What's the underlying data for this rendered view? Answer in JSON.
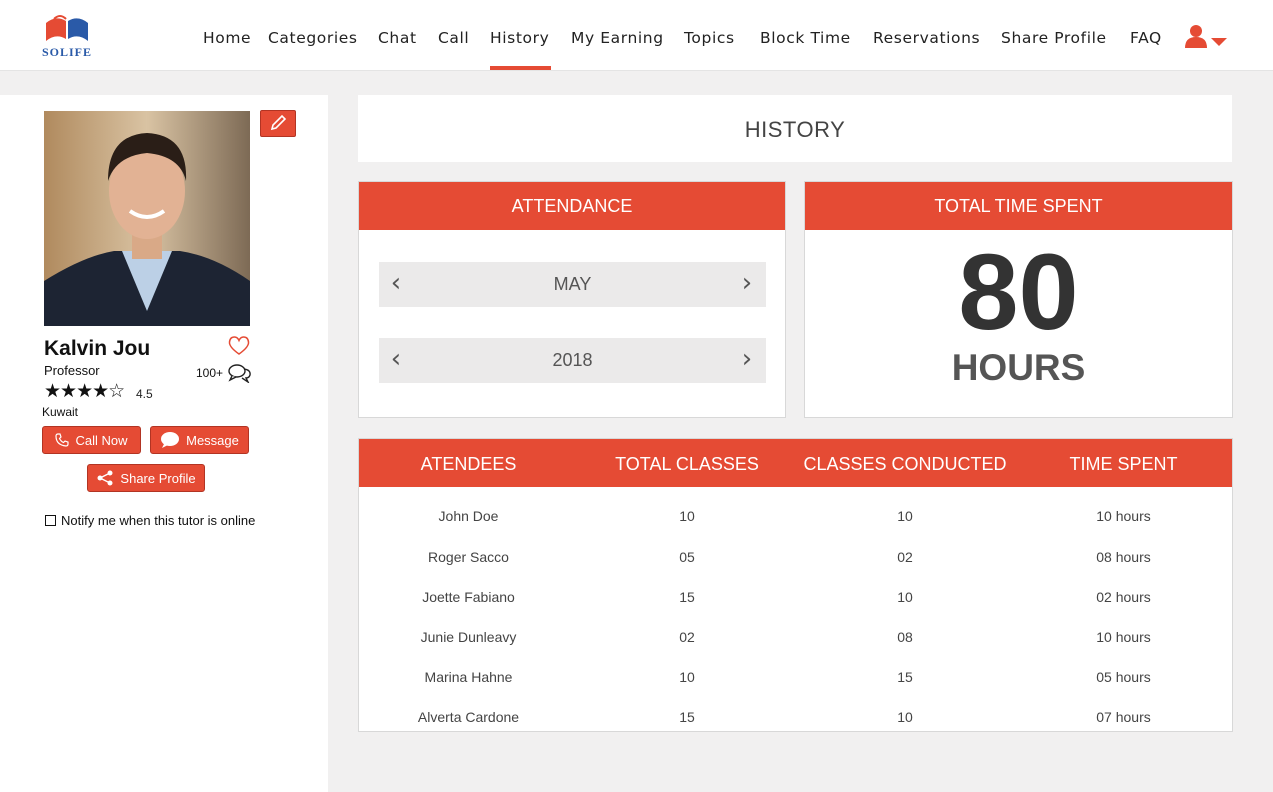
{
  "brand": {
    "logo_text": "SOLIFE",
    "accent": "#e54b34",
    "logo_blue": "#2a5aa8"
  },
  "nav": {
    "items": [
      "Home",
      "Categories",
      "Chat",
      "Call",
      "History",
      "My Earning",
      "Topics",
      "Block Time",
      "Reservations",
      "Share Profile",
      "FAQ"
    ],
    "active": "History",
    "user_icon": "user-icon"
  },
  "profile": {
    "name": "Kalvin Jou",
    "title": "Professor",
    "rating": 4.5,
    "rating_label": "4.5",
    "reviews_count": "100+",
    "country": "Kuwait",
    "call_label": "Call Now",
    "message_label": "Message",
    "share_label": "Share Profile",
    "notify_label": "Notify me when this tutor is online"
  },
  "history": {
    "title": "HISTORY",
    "attendance": {
      "title": "ATTENDANCE",
      "month": "MAY",
      "year": "2018"
    },
    "time_spent": {
      "title": "TOTAL TIME SPENT",
      "value": "80",
      "unit": "HOURS"
    }
  },
  "table": {
    "headers": [
      "ATENDEES",
      "TOTAL CLASSES",
      "CLASSES CONDUCTED",
      "TIME SPENT"
    ],
    "rows": [
      [
        "John Doe",
        "10",
        "10",
        "10 hours"
      ],
      [
        "Roger Sacco",
        "05",
        "02",
        "08 hours"
      ],
      [
        "Joette Fabiano",
        "15",
        "10",
        "02 hours"
      ],
      [
        "Junie Dunleavy",
        "02",
        "08",
        "10 hours"
      ],
      [
        "Marina Hahne",
        "10",
        "15",
        "05 hours"
      ],
      [
        "Alverta Cardone",
        "15",
        "10",
        "07 hours"
      ]
    ]
  }
}
